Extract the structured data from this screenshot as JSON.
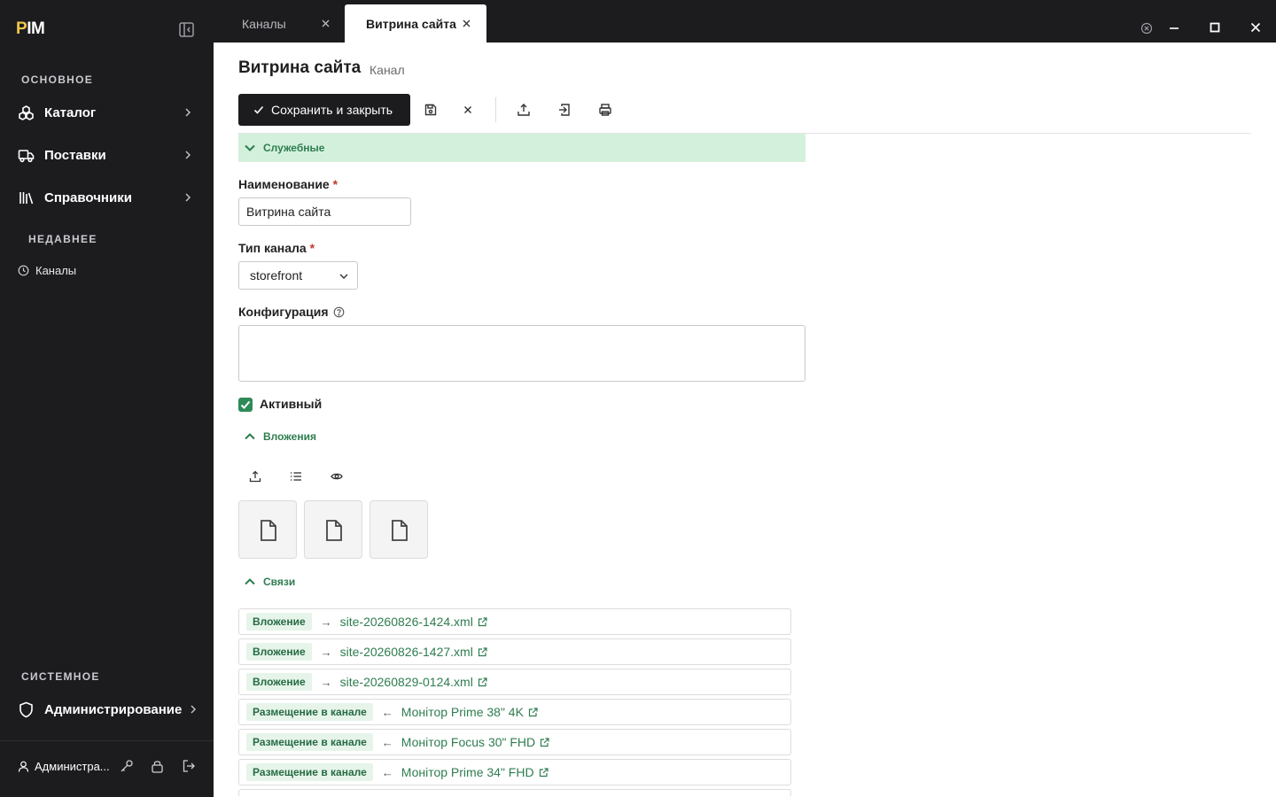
{
  "app": {
    "logo_p": "P",
    "logo_rest": "IM"
  },
  "sidebar": {
    "section_main": "ОСНОВНОЕ",
    "items": [
      {
        "label": "Каталог",
        "icon": "cubes-icon"
      },
      {
        "label": "Поставки",
        "icon": "truck-icon"
      },
      {
        "label": "Справочники",
        "icon": "library-icon"
      }
    ],
    "section_recent": "НЕДАВНЕЕ",
    "recent": [
      {
        "label": "Каналы",
        "icon": "clock-icon"
      }
    ],
    "section_system": "СИСТЕМНОЕ",
    "admin": {
      "label": "Администрирование",
      "icon": "shield-icon"
    },
    "user": {
      "name": "Администра..."
    }
  },
  "tabs": [
    {
      "label": "Каналы",
      "active": false
    },
    {
      "label": "Витрина сайта",
      "active": true
    }
  ],
  "page": {
    "title": "Витрина сайта",
    "subtitle": "Канал"
  },
  "toolbar": {
    "save_close_label": "Сохранить и закрыть"
  },
  "form": {
    "section_service": "Служебные",
    "name_label": "Наименование",
    "name_value": "Витрина сайта",
    "req_mark": "*",
    "type_label": "Тип канала",
    "type_value": "storefront",
    "config_label": "Конфигурация",
    "config_value": "",
    "active_label": "Активный",
    "active_checked": true
  },
  "attachments": {
    "section_label": "Вложения",
    "count": 3
  },
  "relations": {
    "section_label": "Связи",
    "items": [
      {
        "type": "Вложение",
        "arrow": "→",
        "link": "site-20260826-1424.xml"
      },
      {
        "type": "Вложение",
        "arrow": "→",
        "link": "site-20260826-1427.xml"
      },
      {
        "type": "Вложение",
        "arrow": "→",
        "link": "site-20260829-0124.xml"
      },
      {
        "type": "Размещение в канале",
        "arrow": "←",
        "link": "Монітор Prime 38\" 4K"
      },
      {
        "type": "Размещение в канале",
        "arrow": "←",
        "link": "Монітор Focus 30\" FHD"
      },
      {
        "type": "Размещение в канале",
        "arrow": "←",
        "link": "Монітор Prime 34\" FHD"
      }
    ]
  },
  "colors": {
    "accent": "#2e7d4f",
    "section_bg": "#d3f0dd",
    "sidebar_bg": "#1c1c1f"
  }
}
